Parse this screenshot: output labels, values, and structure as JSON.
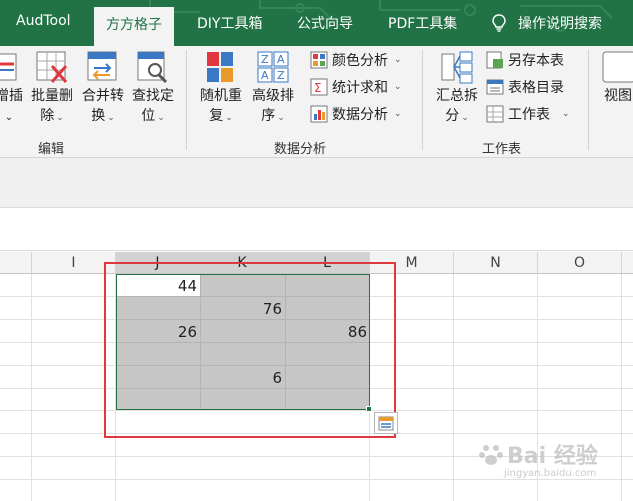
{
  "tabs": [
    {
      "label": "AudTool"
    },
    {
      "label": "方方格子"
    },
    {
      "label": "DIY工具箱"
    },
    {
      "label": "公式向导"
    },
    {
      "label": "PDF工具集"
    }
  ],
  "help": {
    "label": "操作说明搜索",
    "icon": "lightbulb-icon"
  },
  "ribbon": {
    "edit_group": {
      "label": "编辑",
      "partial_button": {
        "line1": "增插",
        "line2": "⌄"
      },
      "batch_delete": {
        "line1": "批量删",
        "line2": "除"
      },
      "merge_convert": {
        "line1": "合并转",
        "line2": "换"
      },
      "find_locate": {
        "line1": "查找定",
        "line2": "位"
      }
    },
    "data_group": {
      "label": "数据分析",
      "random_repeat": {
        "line1": "随机重",
        "line2": "复"
      },
      "advanced_sort": {
        "line1": "高级排",
        "line2": "序"
      },
      "color_analysis": "颜色分析",
      "stats_sum": "统计求和",
      "data_analysis": "数据分析"
    },
    "sheet_group": {
      "label": "工作表",
      "summary_split": {
        "line1": "汇总拆",
        "line2": "分"
      },
      "save_as_sheet": "另存本表",
      "sheet_directory": "表格目录",
      "worksheet": "工作表"
    },
    "view_group": {
      "view": "视图"
    }
  },
  "grid": {
    "columns": [
      "I",
      "J",
      "K",
      "L",
      "M",
      "N",
      "O"
    ],
    "selected_columns": [
      "J",
      "K",
      "L"
    ],
    "cells": {
      "J1": "44",
      "K2": "76",
      "J3": "26",
      "L3": "86",
      "K5": "6"
    }
  },
  "watermark": {
    "text": "Bai 经验",
    "sub": "jingyan.baidu.com"
  },
  "colors": {
    "brand": "#217346",
    "highlight": "#e0383e",
    "selection": "#c6c6c6"
  }
}
